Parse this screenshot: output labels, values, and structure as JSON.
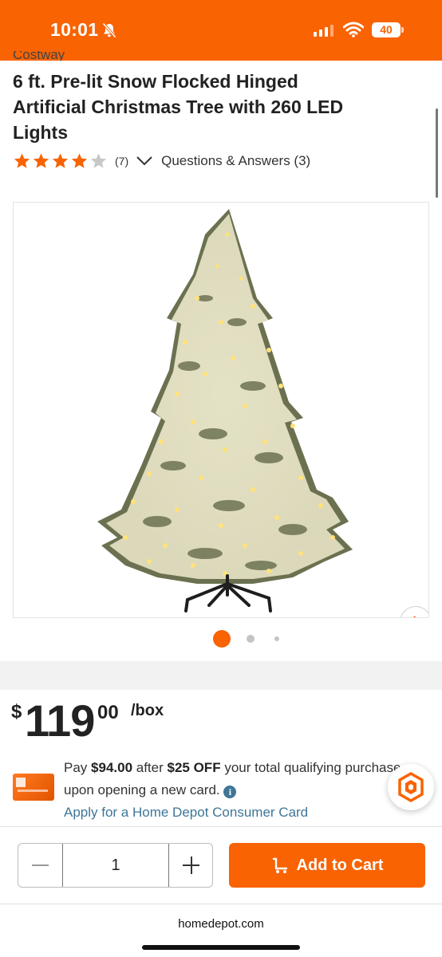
{
  "status_bar": {
    "time": "10:01",
    "battery": "40",
    "accent": "#f96302"
  },
  "product": {
    "brand_partial": "Costway",
    "title": "6 ft. Pre-lit Snow Flocked Hinged Artificial Christmas Tree with 260 LED Lights",
    "rating": 4,
    "rating_max": 5,
    "rating_count": "(7)",
    "qa_label": "Questions & Answers (3)",
    "image_count": 3,
    "active_image": 1
  },
  "price": {
    "dollar_sign": "$",
    "main": "119",
    "cents": "00",
    "unit": "/box"
  },
  "offer": {
    "pay": "Pay ",
    "amount": "$94.00",
    "after": " after ",
    "discount": "$25 OFF",
    "rest": " your total qualifying purchase",
    "line2": "upon opening a new card.",
    "info_icon": "i",
    "apply_link": "Apply for a Home Depot Consumer Card"
  },
  "cart": {
    "quantity": "1",
    "add_label": "Add to Cart"
  },
  "browser": {
    "url": "homedepot.com"
  },
  "colors": {
    "brand_orange": "#f96302",
    "link_blue": "#3e7697",
    "star_empty": "#c8c8c8"
  }
}
